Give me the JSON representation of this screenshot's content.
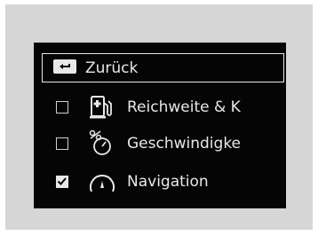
{
  "menu": {
    "back": {
      "label": "Zurück",
      "icon": "back-arrow-icon"
    },
    "items": [
      {
        "label": "Reichweite & K",
        "icon": "fuel-range-icon",
        "checked": false
      },
      {
        "label": "Geschwindigke",
        "icon": "speed-percent-icon",
        "checked": false
      },
      {
        "label": "Navigation",
        "icon": "navigation-gauge-icon",
        "checked": true
      }
    ]
  }
}
